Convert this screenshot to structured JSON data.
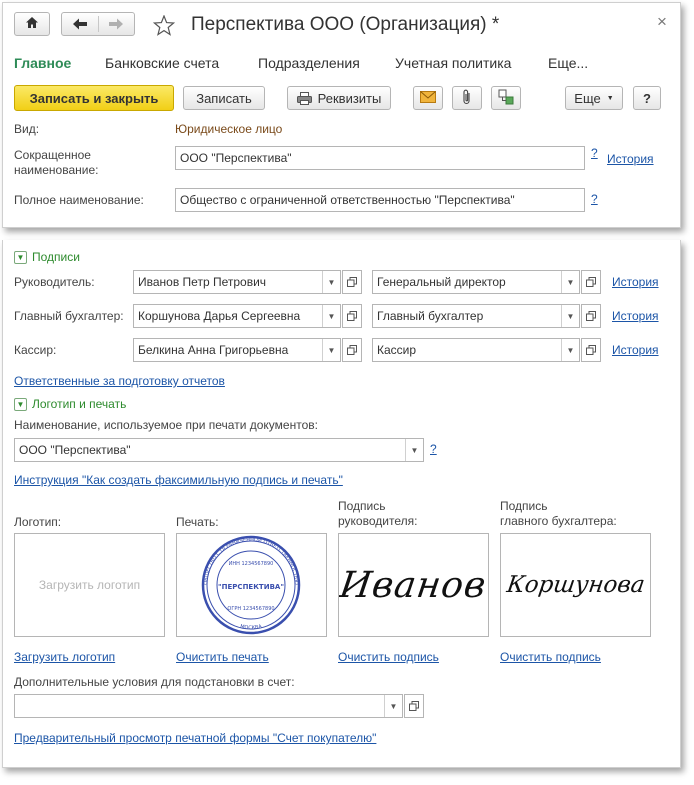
{
  "window": {
    "title": "Перспектива ООО (Организация) *",
    "close": "×"
  },
  "tabs": [
    "Главное",
    "Банковские счета",
    "Подразделения",
    "Учетная политика",
    "Еще..."
  ],
  "toolbar": {
    "save_close": "Записать и закрыть",
    "save": "Записать",
    "requisites": "Реквизиты",
    "more": "Еще",
    "help": "?"
  },
  "main": {
    "kind_label": "Вид:",
    "kind_value": "Юридическое лицо",
    "short_name_label": "Сокращенное наименование:",
    "short_name_value": "ООО \"Перспектива\"",
    "full_name_label": "Полное наименование:",
    "full_name_value": "Общество с ограниченной ответственностью \"Перспектива\"",
    "history": "История",
    "q": "?"
  },
  "signatures": {
    "section_title": "Подписи",
    "rows": [
      {
        "label": "Руководитель:",
        "person": "Иванов Петр Петрович",
        "position": "Генеральный директор",
        "history": "История"
      },
      {
        "label": "Главный бухгалтер:",
        "person": "Коршунова Дарья Сергеевна",
        "position": "Главный бухгалтер",
        "history": "История"
      },
      {
        "label": "Кассир:",
        "person": "Белкина Анна  Григорьевна",
        "position": "Кассир",
        "history": "История"
      }
    ],
    "responsible_link": "Ответственные за подготовку отчетов"
  },
  "logo_section": {
    "section_title": "Логотип и печать",
    "print_name_label": "Наименование, используемое при печати документов:",
    "print_name_value": "ООО \"Перспектива\"",
    "q": "?",
    "instruction_link": "Инструкция \"Как создать факсимильную подпись и печать\"",
    "logo_label": "Логотип:",
    "stamp_label": "Печать:",
    "head_sig_label_1": "Подпись",
    "head_sig_label_2": "руководителя:",
    "acc_sig_label_1": "Подпись",
    "acc_sig_label_2": "главного бухгалтера:",
    "logo_placeholder": "Загрузить логотип",
    "stamp_center": "\"ПЕРСПЕКТИВА\"",
    "stamp_ring_top": "ОБЩЕСТВО С ОГРАНИЧЕННОЙ ОТВЕТСТВЕННОСТЬЮ",
    "stamp_inn": "ИНН 1234567890",
    "stamp_ogrn": "ОГРН 1234567890",
    "stamp_city": "МОСКВА",
    "head_signature": "Иванов",
    "acc_signature": "Коршунова",
    "load_logo_link": "Загрузить логотип",
    "clear_stamp_link": "Очистить печать",
    "clear_head_sig_link": "Очистить подпись",
    "clear_acc_sig_link": "Очистить подпись",
    "extra_label": "Дополнительные условия для подстановки в счет:",
    "extra_value": "",
    "preview_link": "Предварительный просмотр печатной формы \"Счет покупателю\""
  }
}
